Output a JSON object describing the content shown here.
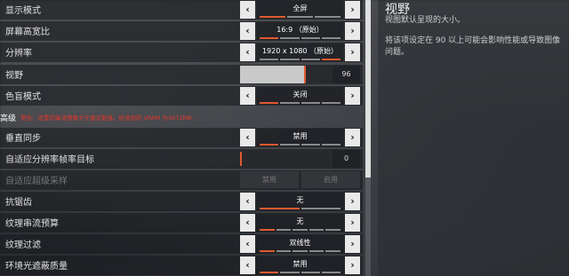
{
  "settings": {
    "display_mode": {
      "label": "显示模式",
      "value": "全屏"
    },
    "aspect_ratio": {
      "label": "屏幕高宽比",
      "value": "16:9 （原始）"
    },
    "resolution": {
      "label": "分辨率",
      "value": "1920 x 1080 （原始）"
    },
    "fov": {
      "label": "视野",
      "value": "96",
      "fill_fraction": 0.71
    },
    "colorblind": {
      "label": "色盲模式",
      "value": "关闭"
    },
    "advanced_header": "高级",
    "vram_warning": "警告：设置的串流预算大于建议数值。检测到的 VRAM 为3072MB.",
    "vsync": {
      "label": "垂直同步",
      "value": "禁用"
    },
    "adaptive_res": {
      "label": "自适应分辨率帧率目标",
      "value": "0",
      "fill_fraction": 0.0
    },
    "adaptive_supersample": {
      "label": "自适应超级采样",
      "btn1": "禁用",
      "btn2": "启用"
    },
    "antialiasing": {
      "label": "抗锯齿",
      "value": "无"
    },
    "texture_budget": {
      "label": "纹理串流预算",
      "value": "无"
    },
    "texture_filter": {
      "label": "纹理过滤",
      "value": "双线性"
    },
    "ambient_occlusion": {
      "label": "环境光遮蔽质量",
      "value": "禁用"
    }
  },
  "help": {
    "title": "视野",
    "subtitle": "视图默认呈现的大小。",
    "description": "将该项设定在 90 以上可能会影响性能或导致图像问题。"
  },
  "icons": {
    "left": "chevron-left-icon",
    "right": "chevron-right-icon"
  },
  "colors": {
    "accent": "#e05a2f",
    "warning": "#e8362b"
  }
}
